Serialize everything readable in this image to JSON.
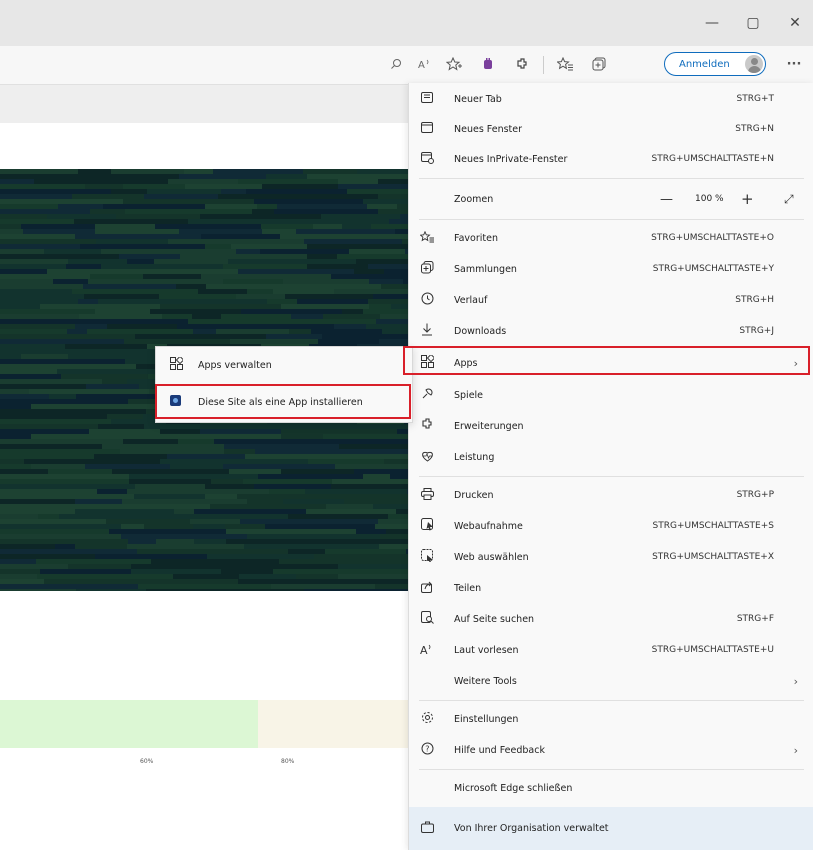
{
  "window": {
    "minimize_glyph": "—",
    "maximize_glyph": "▢",
    "close_glyph": "✕"
  },
  "toolbar": {
    "signin_label": "Anmelden",
    "more_glyph": "···",
    "icons": [
      "search-icon",
      "read-aloud-icon",
      "add-favorite-icon",
      "extension-icon",
      "extensions-icon",
      "favorites-icon",
      "collections-icon",
      "avatar-icon",
      "more-icon"
    ]
  },
  "menu": {
    "new_tab": {
      "label": "Neuer Tab",
      "shortcut": "STRG+T"
    },
    "new_window": {
      "label": "Neues Fenster",
      "shortcut": "STRG+N"
    },
    "new_inprivate": {
      "label": "Neues InPrivate-Fenster",
      "shortcut": "STRG+UMSCHALTTASTE+N"
    },
    "zoom": {
      "label": "Zoomen",
      "minus": "—",
      "value": "100 %",
      "plus": "+",
      "fullscreen": "⤢"
    },
    "favorites": {
      "label": "Favoriten",
      "shortcut": "STRG+UMSCHALTTASTE+O"
    },
    "collections": {
      "label": "Sammlungen",
      "shortcut": "STRG+UMSCHALTTASTE+Y"
    },
    "history": {
      "label": "Verlauf",
      "shortcut": "STRG+H"
    },
    "downloads": {
      "label": "Downloads",
      "shortcut": "STRG+J"
    },
    "apps": {
      "label": "Apps",
      "chevron": "›"
    },
    "games": {
      "label": "Spiele"
    },
    "extensions": {
      "label": "Erweiterungen"
    },
    "performance": {
      "label": "Leistung"
    },
    "print": {
      "label": "Drucken",
      "shortcut": "STRG+P"
    },
    "screenshot": {
      "label": "Webaufnahme",
      "shortcut": "STRG+UMSCHALTTASTE+S"
    },
    "web_select": {
      "label": "Web auswählen",
      "shortcut": "STRG+UMSCHALTTASTE+X"
    },
    "share": {
      "label": "Teilen"
    },
    "find": {
      "label": "Auf Seite suchen",
      "shortcut": "STRG+F"
    },
    "read_aloud": {
      "label": "Laut vorlesen",
      "shortcut": "STRG+UMSCHALTTASTE+U"
    },
    "more_tools": {
      "label": "Weitere Tools",
      "chevron": "›"
    },
    "settings": {
      "label": "Einstellungen"
    },
    "help": {
      "label": "Hilfe und Feedback",
      "chevron": "›"
    },
    "close_edge": {
      "label": "Microsoft Edge schließen"
    },
    "managed": {
      "label": "Von Ihrer Organisation verwaltet"
    }
  },
  "submenu": {
    "manage_apps": {
      "label": "Apps verwalten"
    },
    "install_site": {
      "label": "Diese Site als eine App installieren"
    }
  },
  "page": {
    "tick_labels": [
      "60%",
      "80%"
    ]
  },
  "colors": {
    "highlight": "#d9202a",
    "signin_accent": "#0f6cbd",
    "managed_bg": "#e6eef6"
  }
}
